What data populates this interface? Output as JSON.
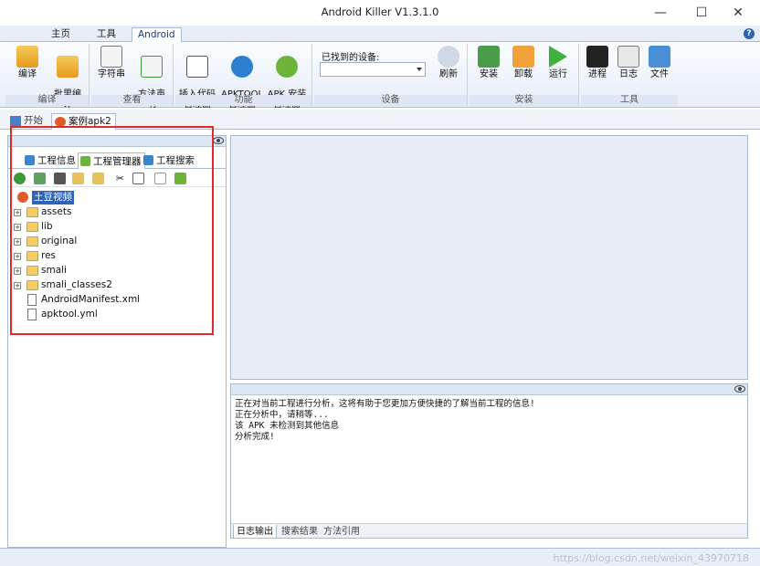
{
  "window": {
    "title": "Android Killer V1.3.1.0"
  },
  "menu_tabs": [
    {
      "label": "主页"
    },
    {
      "label": "工具"
    },
    {
      "label": "Android"
    }
  ],
  "ribbon": {
    "compile_group": {
      "label": "编译",
      "buttons": [
        {
          "label": "编译"
        },
        {
          "label": "批里编\n译"
        }
      ]
    },
    "view_group": {
      "label": "查看",
      "buttons": [
        {
          "label": "字符串"
        },
        {
          "label": "方法声\n明"
        }
      ]
    },
    "function_group": {
      "label": "功能",
      "buttons": [
        {
          "label": "插入代码\n管理器"
        },
        {
          "label": "APKTOOL\n管理器"
        },
        {
          "label": "APK 安装\n管理器"
        }
      ]
    },
    "device_group": {
      "label": "设备",
      "found_label": "已找到的设备:",
      "refresh_label": "刷新"
    },
    "install_group": {
      "label": "安装",
      "buttons": [
        {
          "label": "安装"
        },
        {
          "label": "卸载"
        },
        {
          "label": "运行"
        }
      ]
    },
    "tools_group": {
      "label": "工具",
      "buttons": [
        {
          "label": "进程"
        },
        {
          "label": "日志"
        },
        {
          "label": "文件"
        }
      ]
    }
  },
  "doc_tabs": [
    {
      "label": "开始"
    },
    {
      "label": "案例apk2"
    }
  ],
  "left_panel": {
    "tabs": [
      {
        "label": "工程信息"
      },
      {
        "label": "工程管理器"
      },
      {
        "label": "工程搜索"
      }
    ],
    "tree_root": "土豆视频",
    "tree_items": [
      {
        "label": "assets",
        "kind": "folder"
      },
      {
        "label": "lib",
        "kind": "folder"
      },
      {
        "label": "original",
        "kind": "folder"
      },
      {
        "label": "res",
        "kind": "folder"
      },
      {
        "label": "smali",
        "kind": "folder"
      },
      {
        "label": "smali_classes2",
        "kind": "folder"
      },
      {
        "label": "AndroidManifest.xml",
        "kind": "file"
      },
      {
        "label": "apktool.yml",
        "kind": "file"
      }
    ]
  },
  "log": {
    "lines": [
      "正在对当前工程进行分析，这将有助于您更加方便快捷的了解当前工程的信息!",
      "正在分析中，请稍等...",
      "该 APK 未检测到其他信息",
      "分析完成!"
    ],
    "tabs": [
      {
        "label": "日志输出"
      },
      {
        "label": "搜索结果"
      },
      {
        "label": "方法引用"
      }
    ]
  },
  "watermark": "https://blog.csdn.net/weixin_43970718",
  "colors": {
    "accent": "#2d64b8",
    "highlight_box": "#e02a2a",
    "pane_bg": "#e6edf7"
  }
}
